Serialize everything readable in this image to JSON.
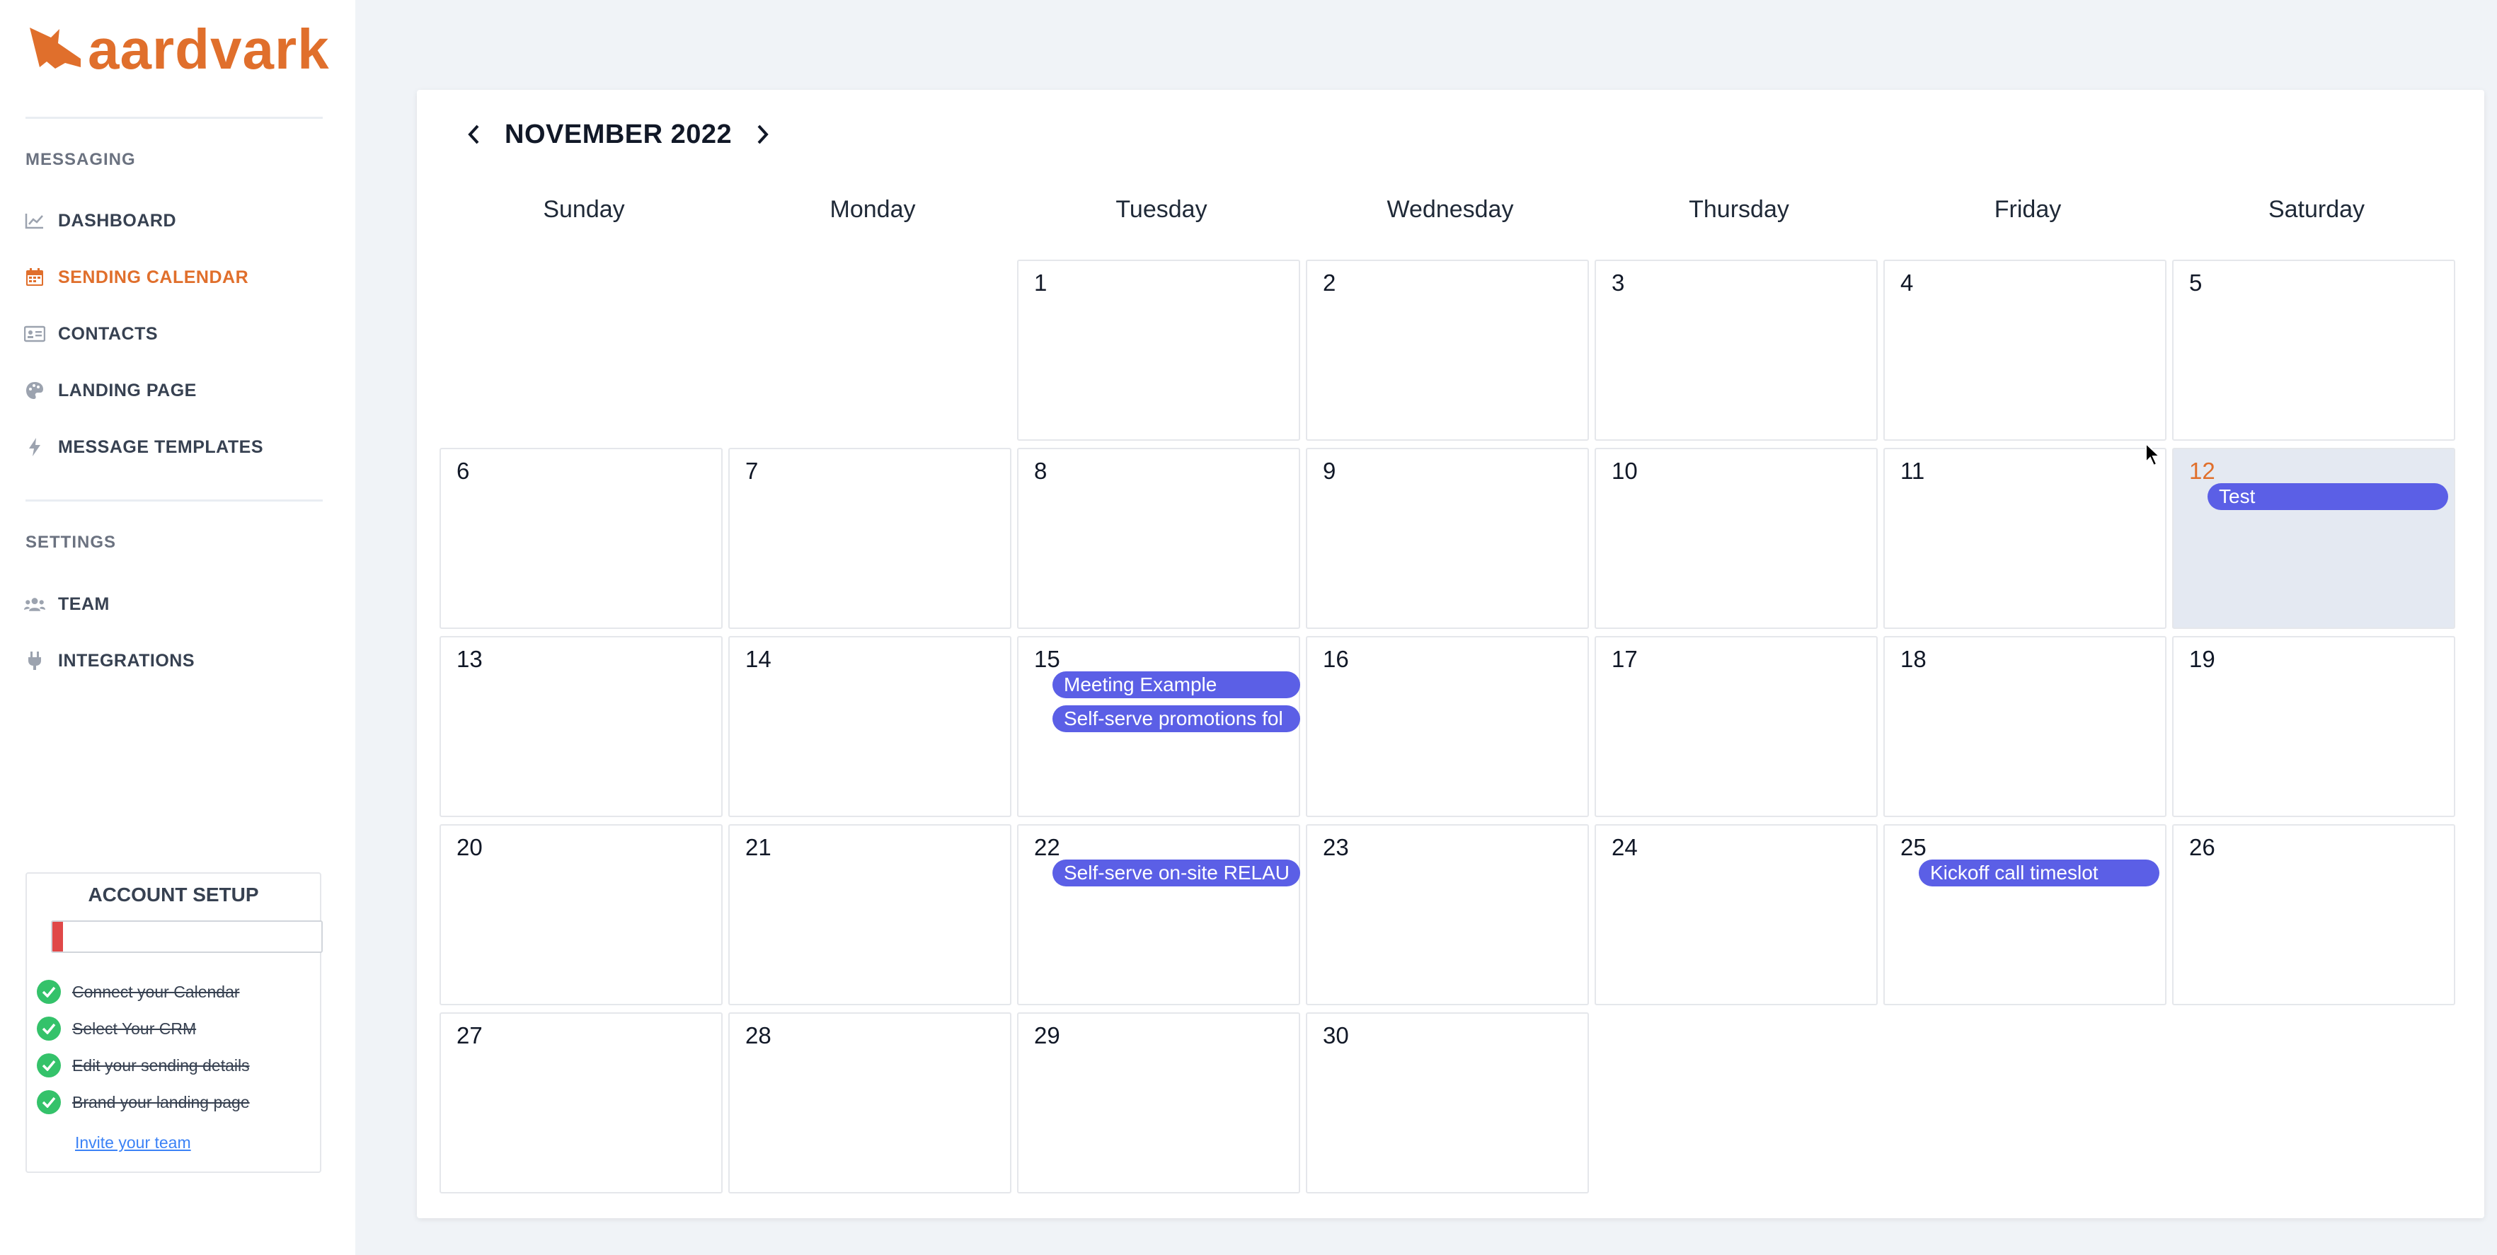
{
  "brand": {
    "name": "aardvark",
    "color": "#e06f2c"
  },
  "sidebar": {
    "messaging_label": "MESSAGING",
    "messaging_items": [
      {
        "label": "DASHBOARD",
        "icon": "chart-line-icon"
      },
      {
        "label": "SENDING CALENDAR",
        "icon": "calendar-icon",
        "active": true
      },
      {
        "label": "CONTACTS",
        "icon": "id-card-icon"
      },
      {
        "label": "LANDING PAGE",
        "icon": "palette-icon"
      },
      {
        "label": "MESSAGE TEMPLATES",
        "icon": "lightning-icon"
      }
    ],
    "settings_label": "SETTINGS",
    "settings_items": [
      {
        "label": "TEAM",
        "icon": "users-icon"
      },
      {
        "label": "INTEGRATIONS",
        "icon": "plug-icon"
      }
    ]
  },
  "account_setup": {
    "title": "ACCOUNT SETUP",
    "progress_fraction": 0.04,
    "items": [
      {
        "label": "Connect your Calendar",
        "done": true
      },
      {
        "label": "Select Your CRM",
        "done": true
      },
      {
        "label": "Edit your sending details",
        "done": true
      },
      {
        "label": "Brand your landing page",
        "done": true
      }
    ],
    "invite_link": "Invite your team",
    "progress_color": "#e04848"
  },
  "calendar": {
    "month_title": "NOVEMBER 2022",
    "weekdays": [
      "Sunday",
      "Monday",
      "Tuesday",
      "Wednesday",
      "Thursday",
      "Friday",
      "Saturday"
    ],
    "first_weekday_index": 2,
    "days_in_month": 30,
    "today": 12,
    "event_color": "#5b5fe6",
    "events": [
      {
        "day": 12,
        "title": "Test"
      },
      {
        "day": 15,
        "title": "Meeting Example"
      },
      {
        "day": 15,
        "title": "Self-serve promotions fol"
      },
      {
        "day": 22,
        "title": "Self-serve on-site RELAU"
      },
      {
        "day": 25,
        "title": "Kickoff call timeslot"
      }
    ]
  }
}
